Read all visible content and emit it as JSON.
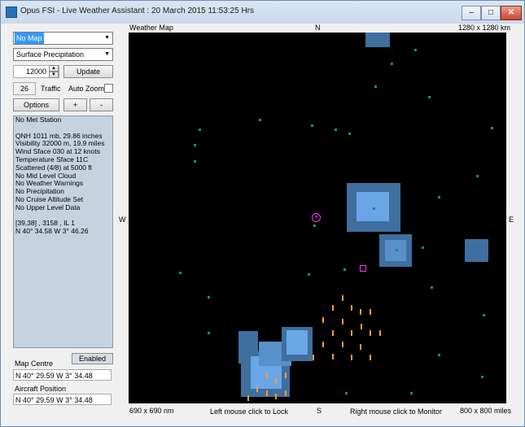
{
  "window": {
    "title": "Opus FSI - Live Weather Assistant : 20 March 2015  11:53:25 Hrs",
    "minimize": "–",
    "maximize": "□",
    "close": "✕"
  },
  "controls": {
    "map_select": "No Map",
    "layer_select": "Surface Precipitation",
    "altitude": "12000",
    "update": "Update",
    "traffic_count": "26",
    "traffic_label": "Traffic",
    "auto_zoom_label": "Auto Zoom",
    "options": "Options",
    "zoom_in": "+",
    "zoom_out": "-"
  },
  "info_lines": [
    "No Met Station",
    "",
    "QNH 1011 mb, 29.86 inches",
    "Visibility 32000 m, 19.9 miles",
    "Wind Sface 030 at 12 knots",
    "Temperature Sface 11C",
    "Scattered (4/8) at 5000 ft",
    "No Mid Level Cloud",
    "No Weather Warnings",
    "No Precipitation",
    "No Cruise Altitude Set",
    "No Upper Level Data",
    "",
    "[39,38] , 3158 , IL 1",
    "N 40° 34.58  W 3° 46.26"
  ],
  "map_centre": {
    "label": "Map Centre",
    "status": "Enabled",
    "value": "N 40° 29.59  W 3° 34.48"
  },
  "aircraft_position": {
    "label": "Aircraft Position",
    "value": "N 40° 29.59  W 3° 34.48"
  },
  "map": {
    "title": "Weather Map",
    "north": "N",
    "south": "S",
    "west": "W",
    "east": "E",
    "range_top": "1280 x 1280 km",
    "size_bottom_left": "690 x 690 nm",
    "hint_left": "Left mouse click to Lock",
    "hint_right": "Right mouse click to Monitor",
    "size_bottom_right": "800 x 800 miles"
  },
  "colors": {
    "map_bg": "#000000",
    "cloud_light": "#6aa6e6",
    "cloud_dark": "#3f6f9f",
    "aircraft": "#ff33ff",
    "rain": "#ff9933",
    "station": "#1f8f6e"
  }
}
